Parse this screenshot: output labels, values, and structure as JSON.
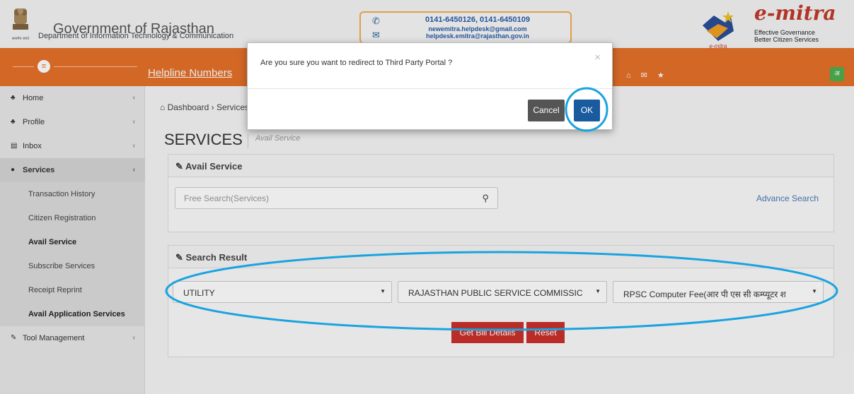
{
  "header": {
    "title": "Government of Rajasthan",
    "department": "Department of Information Technology & Communication",
    "emblem_motto": "सत्यमेव जयते",
    "helpdesk_phones": "0141-6450126, 0141-6450109",
    "helpdesk_email_1": "newemitra.helpdesk@gmail.com",
    "helpdesk_email_2": "helpdesk.emitra@rajasthan.gov.in",
    "brand": "e-mitra",
    "logo_text": "e-mitra",
    "tagline_1": "Effective Governance",
    "tagline_2": "Better Citizen Services"
  },
  "navbar": {
    "helpline_label": "Helpline Numbers",
    "lang_button": "अ",
    "icons": [
      "home-icon",
      "envelope-icon",
      "star-icon"
    ],
    "color": "#e5702a"
  },
  "sidebar": {
    "items": [
      {
        "label": "Home",
        "icon": "dashboard-icon"
      },
      {
        "label": "Profile",
        "icon": "dashboard-icon"
      },
      {
        "label": "Inbox",
        "icon": "files-icon"
      },
      {
        "label": "Services",
        "icon": "check-circle-icon"
      }
    ],
    "subitems": [
      {
        "label": "Transaction History"
      },
      {
        "label": "Citizen Registration"
      },
      {
        "label": "Avail Service"
      },
      {
        "label": "Subscribe Services"
      },
      {
        "label": "Receipt Reprint"
      },
      {
        "label": "Avail Application Services"
      }
    ],
    "tool_management": "Tool Management"
  },
  "main": {
    "breadcrumb_home": "Dashboard",
    "breadcrumb_current": "Services",
    "title": "SERVICES",
    "subtitle": "Avail Service",
    "avail_panel_title": "Avail Service",
    "search_placeholder": "Free Search(Services)",
    "advance_search": "Advance Search",
    "result_panel_title": "Search Result",
    "select_category": "UTILITY",
    "select_department": "RAJASTHAN PUBLIC SERVICE COMMISSIC",
    "select_service": "RPSC Computer Fee(आर पी एस सी कम्प्यूटर श",
    "get_bill_button": "Get Bill Details",
    "reset_button": "Reset"
  },
  "modal": {
    "message": "Are you sure you want to redirect to Third Party Portal ?",
    "close": "×",
    "cancel": "Cancel",
    "ok": "OK"
  },
  "colors": {
    "accent": "#e5702a",
    "primary": "#1a5a9e",
    "danger": "#c9302c",
    "annotation": "#1aa3e0"
  }
}
